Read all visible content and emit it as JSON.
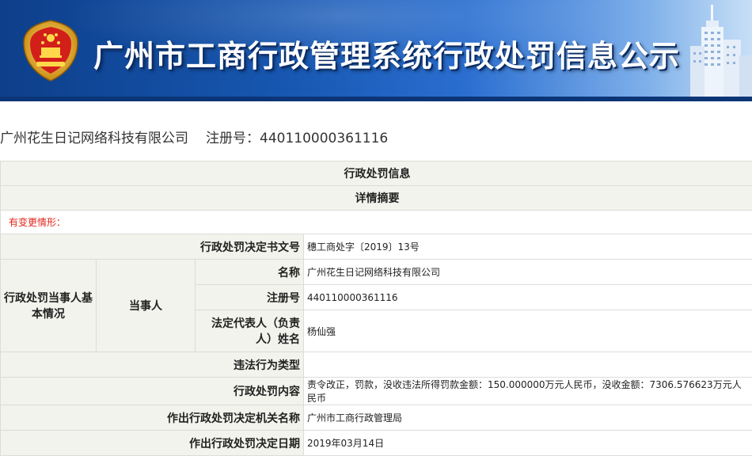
{
  "header": {
    "title": "广州市工商行政管理系统行政处罚信息公示"
  },
  "company": {
    "name": "广州花生日记网络科技有限公司",
    "reg_label": "注册号：",
    "reg_number": "440110000361116"
  },
  "sections": {
    "title": "行政处罚信息",
    "subtitle": "详情摘要",
    "notice": "有变更情形："
  },
  "fields": {
    "decision_no_label": "行政处罚决定书文号",
    "decision_no_value": "穗工商处字〔2019〕13号",
    "party_group_label": "行政处罚当事人基本情况",
    "party_label": "当事人",
    "name_label": "名称",
    "name_value": "广州花生日记网络科技有限公司",
    "reg_label": "注册号",
    "reg_value": "440110000361116",
    "rep_label": "法定代表人（负责人）姓名",
    "rep_value": "杨仙强",
    "violation_type_label": "违法行为类型",
    "violation_type_value": "",
    "content_label": "行政处罚内容",
    "content_value": "责令改正，罚款，没收违法所得罚款金额：150.000000万元人民币，没收金额：7306.576623万元人民币",
    "authority_label": "作出行政处罚决定机关名称",
    "authority_value": "广州市工商行政管理局",
    "date_label": "作出行政处罚决定日期",
    "date_value": "2019年03月14日"
  }
}
